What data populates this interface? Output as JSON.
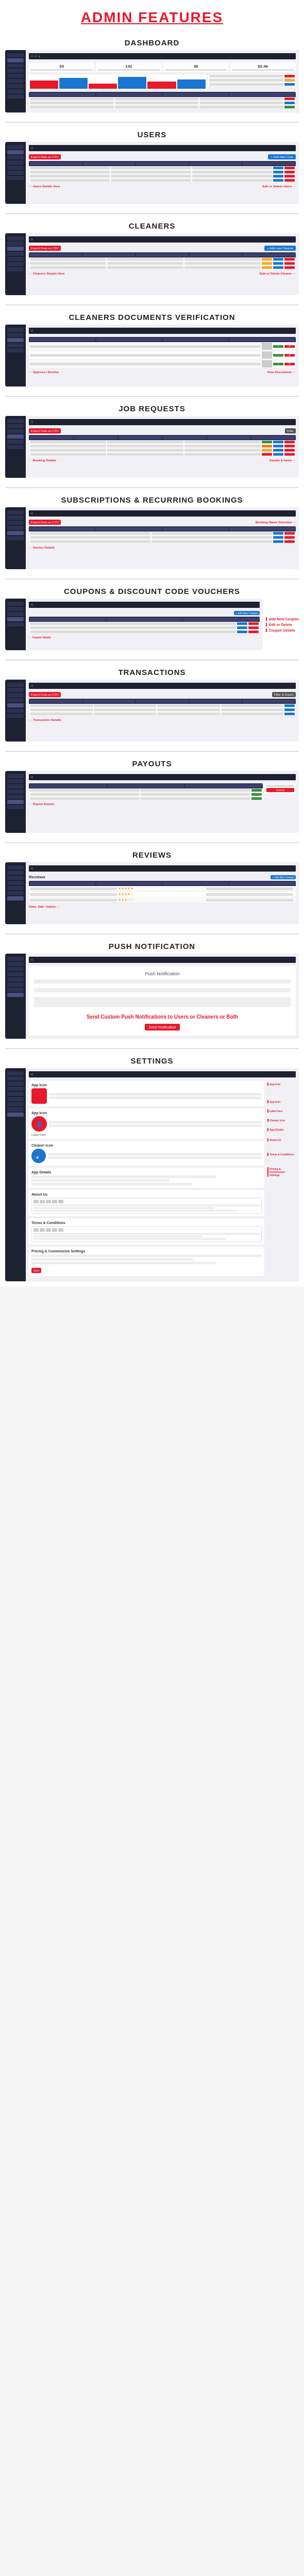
{
  "header": {
    "title": "ADMIN FEATURES"
  },
  "sections": [
    {
      "id": "dashboard",
      "title": "DASHBOARD",
      "annotations": []
    },
    {
      "id": "users",
      "title": "USERS",
      "annotations": [
        "Export Data as CSV",
        "Add New User",
        "Edit or Delete Users",
        "Users Details Here"
      ]
    },
    {
      "id": "cleaners",
      "title": "CLEANERS",
      "annotations": [
        "Export Data as CSV",
        "Add new Cleaner",
        "Edit or Delete Cleaner",
        "Cleaners Details Here"
      ]
    },
    {
      "id": "cleaners-docs",
      "title": "CLEANERS DOCUMENTS VERIFICATION",
      "annotations": [
        "Approve / Decline",
        "View Documents"
      ]
    },
    {
      "id": "job-requests",
      "title": "JOB REQUESTS",
      "annotations": [
        "Export Data as CSV",
        "Filter",
        "Booking Details",
        "Details & Items"
      ]
    },
    {
      "id": "subscriptions",
      "title": "SUBSCRIPTIONS & RECURRING BOOKINGS",
      "annotations": [
        "Export Data as CSV",
        "Booking Name Overview",
        "Service Details"
      ]
    },
    {
      "id": "coupons",
      "title": "COUPONS & DISCOUNT CODE VOUCHERS",
      "annotations": [
        "Add New Coupon",
        "Edit or Delete",
        "Coupon Details"
      ]
    },
    {
      "id": "transactions",
      "title": "TRANSACTIONS",
      "annotations": [
        "Export Data as CSV",
        "Filter & Export",
        "Transaction Details"
      ]
    },
    {
      "id": "payouts",
      "title": "PAYOUTS",
      "annotations": [
        "Custom",
        "Payout Details"
      ]
    },
    {
      "id": "reviews",
      "title": "REVIEWS",
      "annotations": [
        "Add New reviews",
        "Filter, Edit / Delete"
      ]
    },
    {
      "id": "push-notification",
      "title": "PUSH NOTIFICATION",
      "annotations": [
        "Send Custom Push Notifications to Users or Cleaners or Both"
      ]
    },
    {
      "id": "settings",
      "title": "SETTINGS",
      "annotations": [
        "App Icon",
        "App Icon",
        "Label here",
        "Cleaner icon",
        "App Details",
        "About Us",
        "Terms & Conditions",
        "Pricing & Commission Settings"
      ]
    }
  ],
  "colors": {
    "red": "#e8192c",
    "blue": "#1976d2",
    "green": "#388e3c",
    "yellow": "#f9a825",
    "orange": "#f57c00",
    "dark": "#1e2130",
    "sidebar": "#1a1a2e"
  },
  "push_notification": {
    "main_text": "Send Custom Push Notifications to Users or Cleaners or Both"
  }
}
